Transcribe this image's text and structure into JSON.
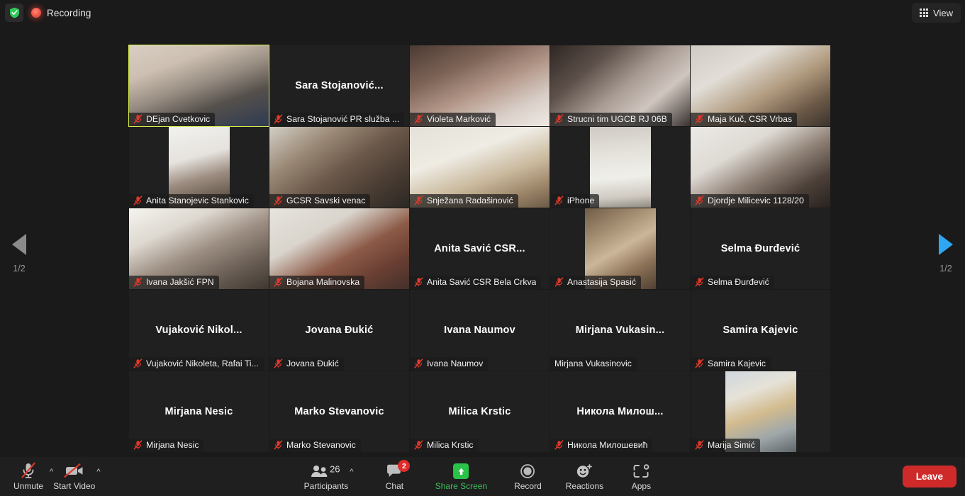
{
  "topbar": {
    "shield_icon": "shield-check-icon",
    "recording_label": "Recording",
    "view_label": "View",
    "view_icon": "grid-icon"
  },
  "pager": {
    "prev_icon": "triangle-left-icon",
    "next_icon": "triangle-right-icon",
    "prev_label": "1/2",
    "next_label": "1/2"
  },
  "gallery": {
    "tiles": [
      {
        "center_name": "",
        "footer_name": "DEjan Cvetkovic",
        "muted": true,
        "video": "bookshelf-man",
        "active": true,
        "fill": "cover"
      },
      {
        "center_name": "Sara  Stojanović...",
        "footer_name": "Sara Stojanović PR služba ...",
        "muted": true,
        "video": "none",
        "active": false,
        "fill": "none"
      },
      {
        "center_name": "",
        "footer_name": "Violeta Marković",
        "muted": true,
        "video": "woman-glasses-room",
        "active": false,
        "fill": "cover"
      },
      {
        "center_name": "",
        "footer_name": "Strucni tim UGCB RJ 06B",
        "muted": true,
        "video": "two-women-office",
        "active": false,
        "fill": "cover"
      },
      {
        "center_name": "",
        "footer_name": "Maja Kuč, CSR Vrbas",
        "muted": true,
        "video": "woman-kitchen",
        "active": false,
        "fill": "cover"
      },
      {
        "center_name": "",
        "footer_name": "Anita Stanojevic Stankovic",
        "muted": true,
        "video": "woman-white-wall",
        "active": false,
        "fill": "contain"
      },
      {
        "center_name": "",
        "footer_name": "GCSR Savski venac",
        "muted": true,
        "video": "meeting-room-group",
        "active": false,
        "fill": "cover"
      },
      {
        "center_name": "",
        "footer_name": "Snježana Radašinović",
        "muted": true,
        "video": "noticeboard-office",
        "active": false,
        "fill": "cover"
      },
      {
        "center_name": "",
        "footer_name": "iPhone",
        "muted": true,
        "video": "ceiling-yellow-flowers",
        "active": false,
        "fill": "contain"
      },
      {
        "center_name": "",
        "footer_name": "Djordje Milicevic 1128/20",
        "muted": true,
        "video": "young-man-glasses",
        "active": false,
        "fill": "cover"
      },
      {
        "center_name": "",
        "footer_name": "Ivana Jakšić FPN",
        "muted": true,
        "video": "woman-window-light",
        "active": false,
        "fill": "cover"
      },
      {
        "center_name": "",
        "footer_name": "Bojana Malinovska",
        "muted": true,
        "video": "woman-red-hair",
        "active": false,
        "fill": "cover"
      },
      {
        "center_name": "Anita  Savić CSR...",
        "footer_name": "Anita Savić CSR Bela Crkva",
        "muted": true,
        "video": "none",
        "active": false,
        "fill": "none"
      },
      {
        "center_name": "",
        "footer_name": "Anastasija Spasić",
        "muted": true,
        "video": "woman-avatar-photo",
        "active": false,
        "fill": "contain"
      },
      {
        "center_name": "Selma Đurđević",
        "footer_name": "Selma Đurđević",
        "muted": true,
        "video": "none",
        "active": false,
        "fill": "none"
      },
      {
        "center_name": "Vujaković  Nikol...",
        "footer_name": "Vujaković Nikoleta, Rafai Ti...",
        "muted": true,
        "video": "none",
        "active": false,
        "fill": "none"
      },
      {
        "center_name": "Jovana Đukić",
        "footer_name": "Jovana Đukić",
        "muted": true,
        "video": "none",
        "active": false,
        "fill": "none"
      },
      {
        "center_name": "Ivana Naumov",
        "footer_name": "Ivana Naumov",
        "muted": true,
        "video": "none",
        "active": false,
        "fill": "none"
      },
      {
        "center_name": "Mirjana  Vukasin...",
        "footer_name": "Mirjana Vukasinovic",
        "muted": false,
        "video": "none",
        "active": false,
        "fill": "none"
      },
      {
        "center_name": "Samira Kajevic",
        "footer_name": "Samira Kajevic",
        "muted": true,
        "video": "none",
        "active": false,
        "fill": "none"
      },
      {
        "center_name": "Mirjana Nesic",
        "footer_name": "Mirjana Nesic",
        "muted": true,
        "video": "none",
        "active": false,
        "fill": "none"
      },
      {
        "center_name": "Marko Stevanovic",
        "footer_name": "Marko Stevanovic",
        "muted": true,
        "video": "none",
        "active": false,
        "fill": "none"
      },
      {
        "center_name": "Milica Krstic",
        "footer_name": "Milica Krstic",
        "muted": true,
        "video": "none",
        "active": false,
        "fill": "none"
      },
      {
        "center_name": "Никола  Милош...",
        "footer_name": "Никола Милошевић",
        "muted": true,
        "video": "none",
        "active": false,
        "fill": "none"
      },
      {
        "center_name": "",
        "footer_name": "Marija Simić",
        "muted": true,
        "video": "blonde-woman-outdoor",
        "active": false,
        "fill": "contain"
      }
    ]
  },
  "toolbar": {
    "unmute_label": "Unmute",
    "unmute_icon": "microphone-muted-icon",
    "start_video_label": "Start Video",
    "start_video_icon": "camera-muted-icon",
    "participants_label": "Participants",
    "participants_icon": "people-icon",
    "participants_count": "26",
    "chat_label": "Chat",
    "chat_icon": "speech-bubble-icon",
    "chat_badge": "2",
    "share_screen_label": "Share Screen",
    "share_screen_icon": "up-arrow-green-icon",
    "record_label": "Record",
    "record_icon": "record-circle-icon",
    "reactions_label": "Reactions",
    "reactions_icon": "smiley-plus-icon",
    "apps_label": "Apps",
    "apps_icon": "apps-brackets-icon",
    "leave_label": "Leave"
  },
  "colors": {
    "active_speaker": "#d6ee4b",
    "leave_red": "#cf2a2a",
    "share_green": "#2bc24a",
    "badge_red": "#e02b2b",
    "next_arrow_blue": "#2ea7f0"
  }
}
